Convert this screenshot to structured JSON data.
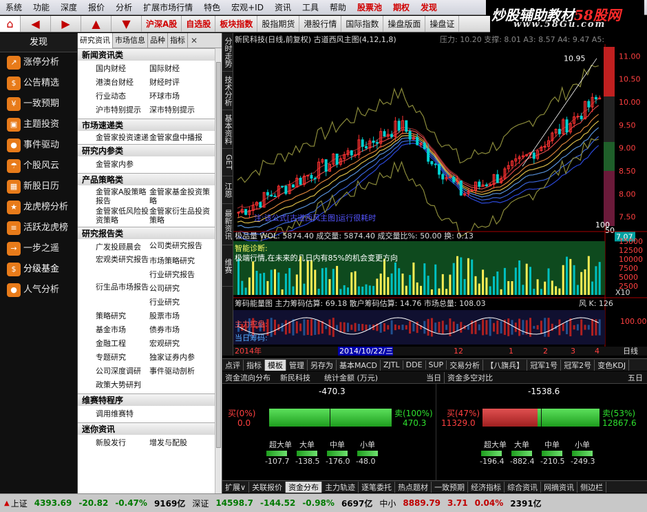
{
  "menubar": [
    "系统",
    "功能",
    "深度",
    "报价",
    "分析",
    "扩展市场行情",
    "特色",
    "宏观+ID",
    "资讯",
    "工具",
    "帮助"
  ],
  "menubar_special": {
    "stock_pool": "股票池",
    "futures": "期权",
    "trade": "发现"
  },
  "brand": {
    "main": "炒股辅助教材",
    "accent": "58股网",
    "url": "www.58Gu.com"
  },
  "toolbar": {
    "buttons": [
      "沪深A股",
      "自选股",
      "板块指数",
      "股指期货",
      "港股行情",
      "国际指数",
      "操盘版面",
      "操盘证"
    ]
  },
  "sidebar": {
    "title": "发现",
    "items": [
      "涨停分析",
      "公告精选",
      "一致预期",
      "主题投资",
      "事件驱动",
      "个股风云",
      "新股日历",
      "龙虎榜分析",
      "活跃龙虎榜",
      "一步之遥",
      "分级基金",
      "人气分析"
    ]
  },
  "panel": {
    "tabs": [
      "研究资讯",
      "市场信息",
      "品种",
      "指标"
    ],
    "sections": [
      {
        "title": "新闻资讯类",
        "items": [
          "国内财经",
          "国际财经",
          "港澳台财经",
          "财经时评",
          "行业动态",
          "环球市场",
          "沪市特别提示",
          "深市特别提示"
        ]
      },
      {
        "title": "市场速递类",
        "items": [
          "金管家投资速递",
          "金管家盘中播报"
        ]
      },
      {
        "title": "研究内参类",
        "items": [
          "金管家内参"
        ]
      },
      {
        "title": "产品策略类",
        "items": [
          "金管家A股策略报告",
          "金管家基金投资策略",
          "金管家低风险投资策略",
          "金管家衍生品投资策略"
        ]
      },
      {
        "title": "研究报告类",
        "items": [
          "广发投顾晨会",
          "公司类研究报告",
          "宏观类研究报告",
          "市场策略研究",
          "",
          "行业研究报告",
          "衍生品市场报告",
          "公司研究",
          "",
          "行业研究",
          "策略研究",
          "股票市场",
          "基金市场",
          "债券市场",
          "金融工程",
          "宏观研究",
          "专题研究",
          "独家证券内参",
          "公司深度调研",
          "事件驱动剖析",
          "政策大势研判",
          ""
        ]
      },
      {
        "title": "维赛特程序",
        "items": [
          "调用维赛特"
        ]
      },
      {
        "title": "迷你资讯",
        "items": [
          "新股发行",
          "增发与配股"
        ]
      }
    ]
  },
  "vtabs": [
    "分时走势",
    "技术分析",
    "基本资料",
    "GET",
    "江恩",
    "最新资讯",
    "维赛"
  ],
  "chart": {
    "header": "新民科技(日线,前复权) 古道西风主图(4,12,1,8)",
    "header_right": "压力: 10.20  支撑: 8.01  A3: 8.57  A4: 9.47  A5:",
    "status_msg": "注:该公式[古道西风主图]运行很耗时",
    "peak_label": "10.95",
    "price_now": "7.07",
    "price_mark": "50",
    "price_axis": [
      "11.00",
      "10.50",
      "10.00",
      "9.50",
      "9.00",
      "8.50",
      "8.00",
      "7.50"
    ],
    "vol_header": "极品量  WOL: 5874.40  成交量: 5874.40      成交量比%: 50.00  换: 0.13",
    "vol_axis": [
      "15000",
      "12500",
      "10000",
      "7500",
      "5000",
      "2500"
    ],
    "vol_unit": "X10",
    "diag_title": "智能诊断:",
    "diag_text": "极端行情,在未来的几日内有85%的机会变更方向",
    "chip_header": "筹码能量图   主力筹码估算: 69.18  散户筹码估算: 14.76  市场总量: 108.03",
    "chip_right": "风 K: 126",
    "chip_axis": "100.00",
    "chip_labels": [
      "主力控盘:",
      "当日筹码:"
    ],
    "date_left": "2014年",
    "date_sel": "2014/10/22/三",
    "date_marks": [
      "12",
      "1",
      "2",
      "3",
      "4"
    ],
    "period": "日线",
    "box_label": "100"
  },
  "indicator_tabs": [
    "点评",
    "指标",
    "模板",
    "管理",
    "另存为",
    "基本MACD",
    "ZJTL",
    "DDE",
    "SUP",
    "交易分析",
    "【八旗兵】",
    "冠军1号",
    "冠军2号",
    "变色KDJ"
  ],
  "flow": {
    "left_header": [
      "资金流向分布",
      "新民科技",
      "统计金额 (万元)",
      "当日"
    ],
    "right_header": [
      "资金多空对比",
      "五日"
    ],
    "left": {
      "net": "-470.3",
      "buy_label": "买(0%)",
      "buy_val": "0.0",
      "sell_label": "卖(100%)",
      "sell_val": "470.3",
      "sell_ratio": 1.0,
      "cats": [
        "超大单",
        "大单",
        "中单",
        "小单"
      ],
      "vals": [
        "-107.7",
        "-138.5",
        "-176.0",
        "-48.0"
      ]
    },
    "right": {
      "net": "-1538.6",
      "buy_label": "买(47%)",
      "buy_val": "11329.0",
      "sell_label": "卖(53%)",
      "sell_val": "12867.6",
      "buy_ratio": 0.47,
      "cats": [
        "超大单",
        "大单",
        "中单",
        "小单"
      ],
      "vals": [
        "-196.4",
        "-882.4",
        "-210.5",
        "-249.3"
      ]
    }
  },
  "bottom_tabs": [
    "扩展∨",
    "关联报价",
    "资金分布",
    "主力轨迹",
    "逐笔委托",
    "热点题材",
    "一致预期",
    "经济指标",
    "综合资讯",
    "网摘资讯",
    "侧边栏"
  ],
  "status": {
    "sh_name": "上证",
    "sh_val": "4393.69",
    "sh_chg": "-20.82",
    "sh_pct": "-0.47%",
    "sh_amt": "9169亿",
    "sz_name": "深证",
    "sz_val": "14598.7",
    "sz_chg": "-144.52",
    "sz_pct": "-0.98%",
    "sz_amt": "6697亿",
    "zx_name": "中小",
    "zx_val": "8889.79",
    "zx_chg": "3.71",
    "zx_pct": "0.04%",
    "zx_amt": "2391亿"
  },
  "colors": {
    "up": "#ff3030",
    "down": "#00d0d0",
    "sidebar_icon": "#e87b1a",
    "green_bar": "#2fbf2f",
    "red_bar": "#c03030"
  }
}
